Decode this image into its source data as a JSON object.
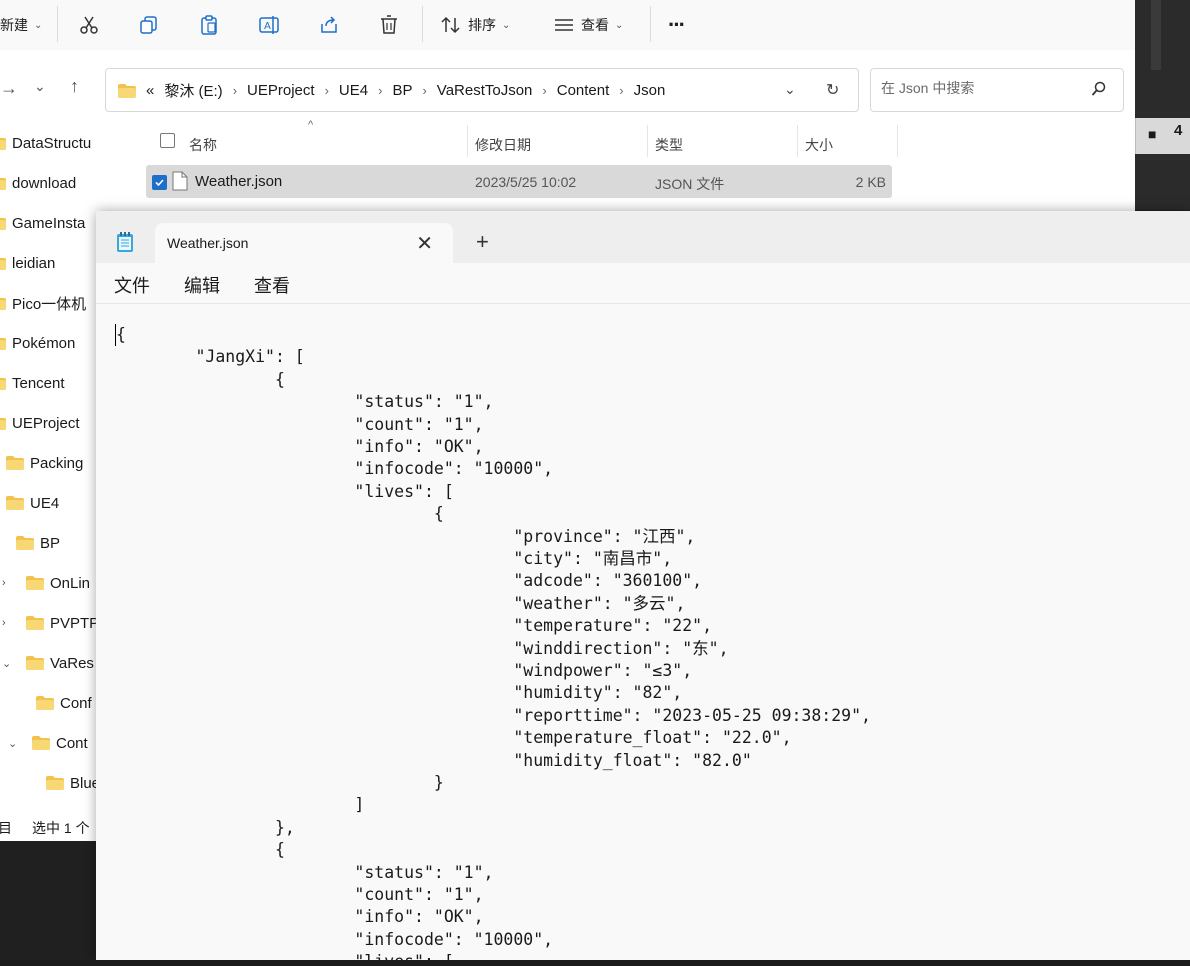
{
  "explorer": {
    "toolbar": {
      "new_label": "新建",
      "sort_label": "排序",
      "view_label": "查看",
      "more_label": "···"
    },
    "address": {
      "overflow": "«",
      "crumbs": [
        "黎沐 (E:)",
        "UEProject",
        "UE4",
        "BP",
        "VaRestToJson",
        "Content",
        "Json"
      ]
    },
    "search_placeholder": "在 Json 中搜索",
    "sidebar": [
      {
        "label": "DataStructu",
        "indent": 0,
        "expander": ""
      },
      {
        "label": "download",
        "indent": 0,
        "expander": ""
      },
      {
        "label": "GameInsta",
        "indent": 0,
        "expander": ""
      },
      {
        "label": "leidian",
        "indent": 0,
        "expander": ""
      },
      {
        "label": "Pico一体机",
        "indent": 0,
        "expander": ""
      },
      {
        "label": "Pokémon",
        "indent": 0,
        "expander": ""
      },
      {
        "label": "Tencent",
        "indent": 0,
        "expander": ""
      },
      {
        "label": "UEProject",
        "indent": 0,
        "expander": ""
      },
      {
        "label": "Packing",
        "indent": 1,
        "expander": ""
      },
      {
        "label": "UE4",
        "indent": 1,
        "expander": ""
      },
      {
        "label": "BP",
        "indent": 2,
        "expander": ""
      },
      {
        "label": "OnLin",
        "indent": 3,
        "expander": "›"
      },
      {
        "label": "PVPTP",
        "indent": 3,
        "expander": "›"
      },
      {
        "label": "VaRes",
        "indent": 3,
        "expander": "⌄"
      },
      {
        "label": "Conf",
        "indent": 4,
        "expander": ""
      },
      {
        "label": "Cont",
        "indent": 4,
        "expander": "⌄"
      },
      {
        "label": "Blue",
        "indent": 5,
        "expander": ""
      }
    ],
    "columns": {
      "name": "名称",
      "modified": "修改日期",
      "type": "类型",
      "size": "大小"
    },
    "file": {
      "name": "Weather.json",
      "modified": "2023/5/25 10:02",
      "type": "JSON 文件",
      "size": "2 KB"
    },
    "status": {
      "items_suffix": "目",
      "selected": "选中 1 个"
    }
  },
  "rightstrip": {
    "badge": "4"
  },
  "notepad": {
    "tab_title": "Weather.json",
    "menu": [
      "文件",
      "编辑",
      "查看"
    ],
    "lines": [
      "{",
      "        \"JangXi\": [",
      "                {",
      "                        \"status\": \"1\",",
      "                        \"count\": \"1\",",
      "                        \"info\": \"OK\",",
      "                        \"infocode\": \"10000\",",
      "                        \"lives\": [",
      "                                {",
      "                                        \"province\": \"江西\",",
      "                                        \"city\": \"南昌市\",",
      "                                        \"adcode\": \"360100\",",
      "                                        \"weather\": \"多云\",",
      "                                        \"temperature\": \"22\",",
      "                                        \"winddirection\": \"东\",",
      "                                        \"windpower\": \"≤3\",",
      "                                        \"humidity\": \"82\",",
      "                                        \"reporttime\": \"2023-05-25 09:38:29\",",
      "                                        \"temperature_float\": \"22.0\",",
      "                                        \"humidity_float\": \"82.0\"",
      "                                }",
      "                        ]",
      "                },",
      "                {",
      "                        \"status\": \"1\",",
      "                        \"count\": \"1\",",
      "                        \"info\": \"OK\",",
      "                        \"infocode\": \"10000\",",
      "                        \"lives\": ["
    ]
  }
}
